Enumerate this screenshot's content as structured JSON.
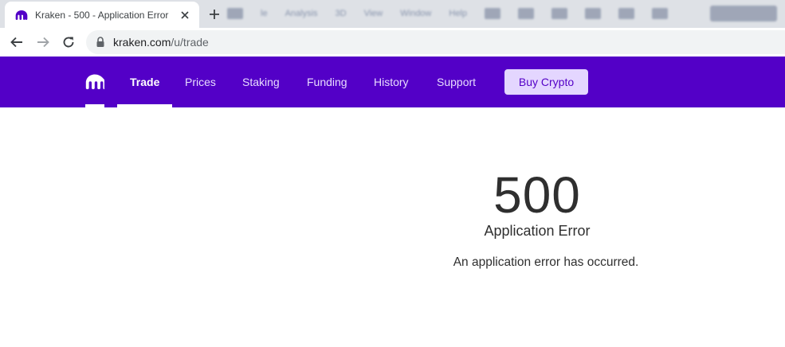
{
  "browser": {
    "tab": {
      "title": "Kraken - 500 - Application Error",
      "favicon": "kraken-logo-icon",
      "close_icon": "close-icon"
    },
    "new_tab_icon": "plus-icon",
    "background_toolbar": [
      "le",
      "Analysis",
      "3D",
      "View",
      "Window",
      "Help"
    ],
    "nav": {
      "back_icon": "arrow-left-icon",
      "forward_icon": "arrow-right-icon",
      "reload_icon": "reload-icon"
    },
    "address": {
      "lock_icon": "lock-icon",
      "domain": "kraken.com",
      "path": "/u/trade"
    }
  },
  "site": {
    "brand_color": "#5300c7",
    "logo_icon": "kraken-logo-icon",
    "nav_items": [
      {
        "label": "Trade",
        "active": true
      },
      {
        "label": "Prices",
        "active": false
      },
      {
        "label": "Staking",
        "active": false
      },
      {
        "label": "Funding",
        "active": false
      },
      {
        "label": "History",
        "active": false
      },
      {
        "label": "Support",
        "active": false
      }
    ],
    "cta_label": "Buy Crypto",
    "cta_color": "#e4d6ff"
  },
  "error": {
    "code": "500",
    "title": "Application Error",
    "message": "An application error has occurred."
  }
}
